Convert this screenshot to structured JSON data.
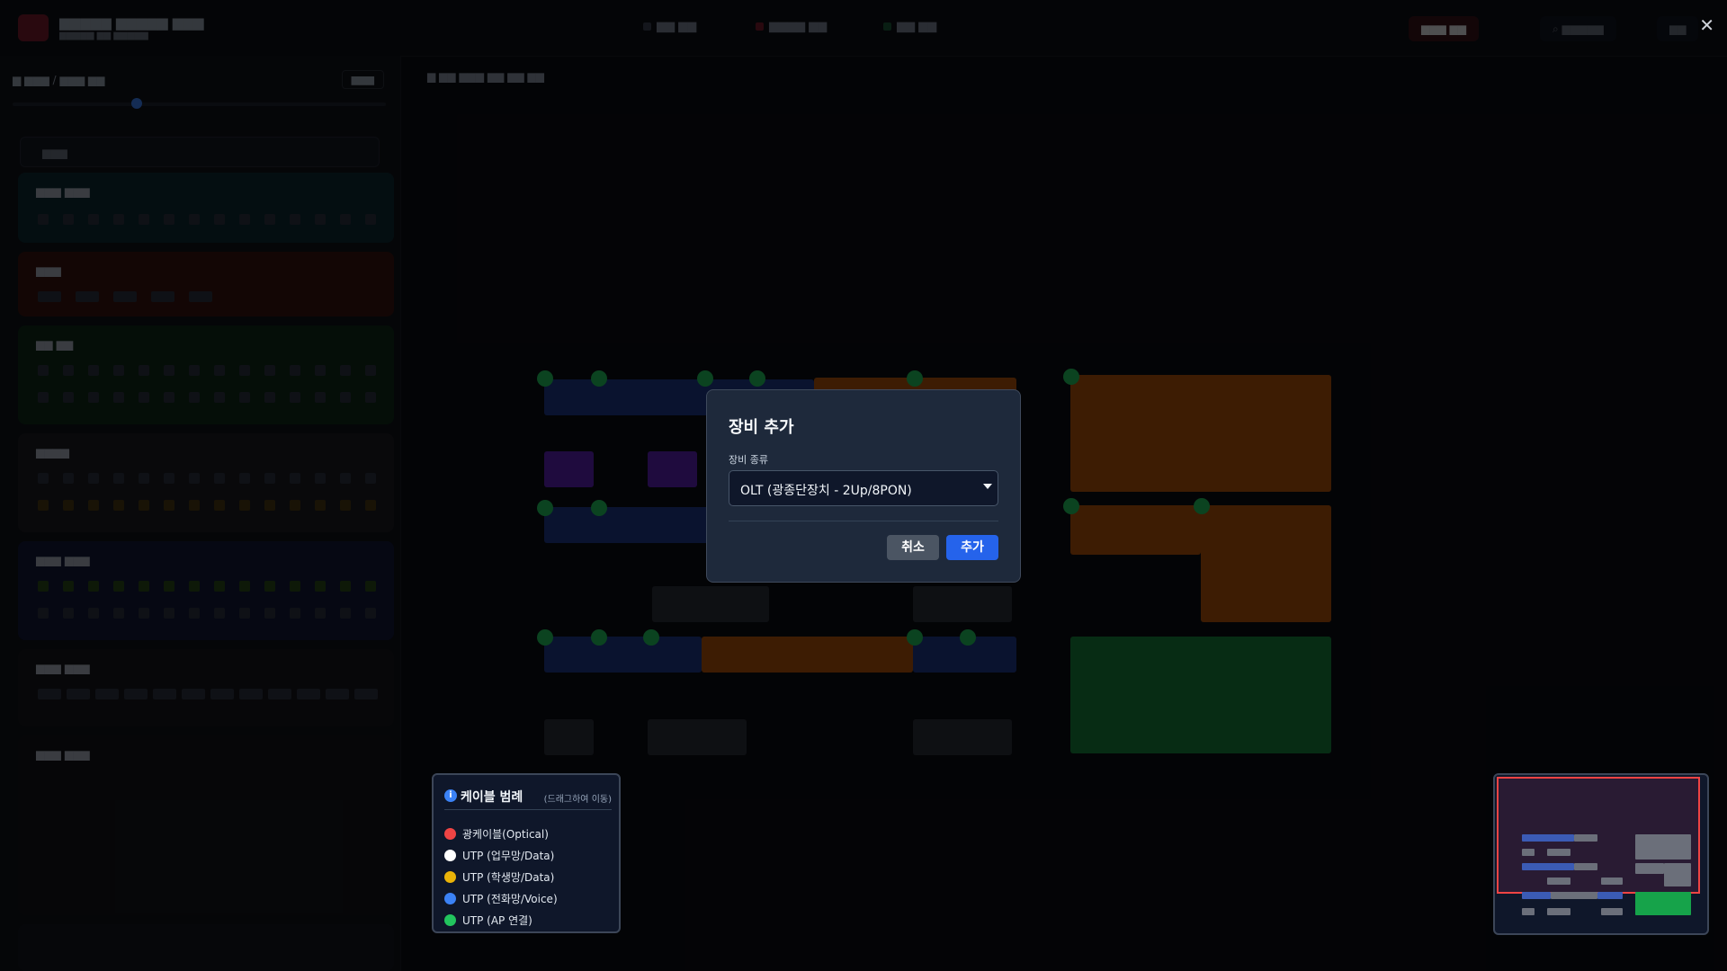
{
  "dialog": {
    "title": "장비 추가",
    "field_label": "장비 종류",
    "selected_option": "OLT (광종단장치 - 2Up/8PON)",
    "cancel_label": "취소",
    "add_label": "추가"
  },
  "legend": {
    "title": "케이블 범례",
    "hint": "(드래그하여 이동)",
    "items": [
      {
        "label": "광케이블(Optical)",
        "color": "#ef4444"
      },
      {
        "label": "UTP (업무망/Data)",
        "color": "#ffffff"
      },
      {
        "label": "UTP (학생망/Data)",
        "color": "#eab308"
      },
      {
        "label": "UTP (전화망/Voice)",
        "color": "#3b82f6"
      },
      {
        "label": "UTP (AP 연결)",
        "color": "#22c55e"
      }
    ]
  },
  "colors": {
    "accent": "#2563eb",
    "minimap_viewport": "#ef4444"
  },
  "icons": {
    "info": "info-icon",
    "close": "close-icon",
    "select_arrow": "chevron-down-icon"
  },
  "glyphs": {
    "info": "i",
    "close": "✕"
  }
}
